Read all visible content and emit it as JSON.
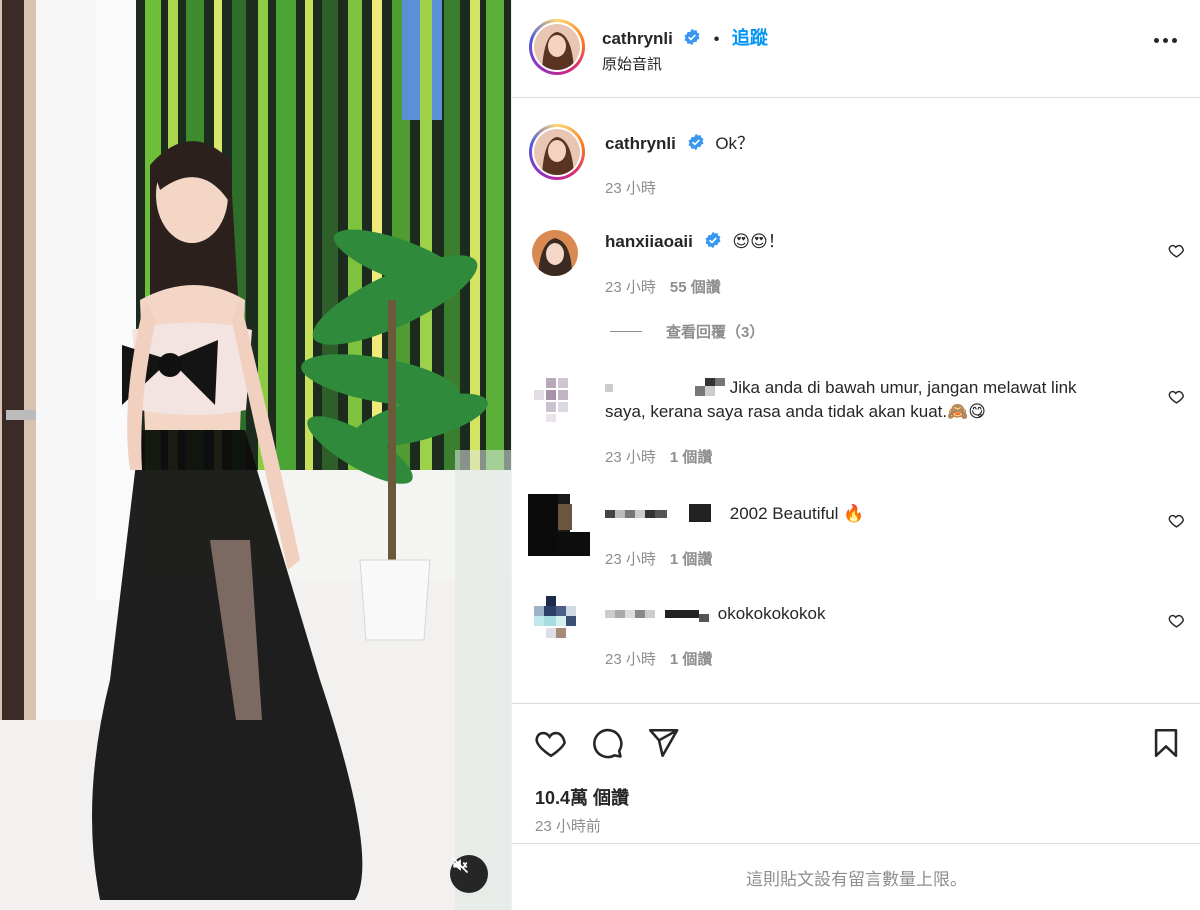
{
  "header": {
    "username": "cathrynli",
    "separator": "•",
    "follow_label": "追蹤",
    "audio": "原始音訊"
  },
  "caption": {
    "username": "cathrynli",
    "text": "Ok？",
    "time": "23 小時"
  },
  "comments": [
    {
      "username": "hanxiiaoaii",
      "text": "😍😍！",
      "time": "23 小時",
      "likes": "55 個讚",
      "view_replies": "查看回覆（3）"
    },
    {
      "username": "",
      "text_line1": "Jika anda di bawah umur, jangan melawat link",
      "text_line2": "saya, kerana saya rasa anda tidak akan kuat.🙈😋",
      "time": "23 小時",
      "likes": "1 個讚"
    },
    {
      "username": "",
      "text": "2002 Beautiful 🔥",
      "time": "23 小時",
      "likes": "1 個讚"
    },
    {
      "username": "",
      "text": "okokokokokok",
      "time": "23 小時",
      "likes": "1 個讚"
    }
  ],
  "post": {
    "likes": "10.4萬 個讚",
    "time": "23 小時前",
    "comment_limit_notice": "這則貼文設有留言數量上限。"
  },
  "icons": {
    "verified": "verified-badge-icon",
    "more": "more-options-icon",
    "heart": "heart-icon",
    "comment": "comment-icon",
    "share": "share-icon",
    "save": "bookmark-icon",
    "mute": "muted-speaker-icon"
  },
  "colors": {
    "link_blue": "#0095f6",
    "verified_blue": "#3897f0",
    "text": "#262626",
    "secondary": "#8e8e8e",
    "border": "#dbdbdb"
  }
}
